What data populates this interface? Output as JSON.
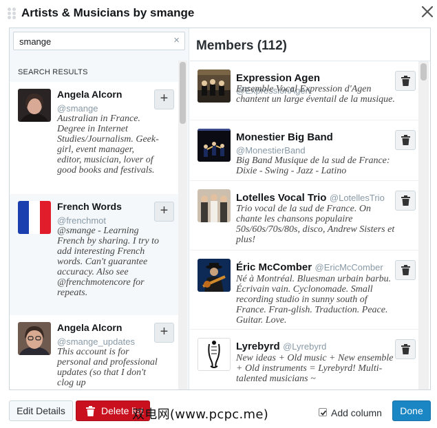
{
  "dialog": {
    "title": "Artists & Musicians by smange"
  },
  "search": {
    "value": "smange",
    "clear": "×"
  },
  "left_panel": {
    "results_label": "SEARCH RESULTS",
    "add": "+",
    "results": [
      {
        "name": "Angela Alcorn",
        "handle": "@smange",
        "bio": "Australian in France. Degree in Internet Studies/Journalism. Geek-girl, event manager, editor, musician, lover of good books and festivals."
      },
      {
        "name": "French Words",
        "handle": "@frenchmot",
        "bio": "@smange - Learning French by sharing. I try to add interesting French words. Can't guarantee accuracy. Also see @frenchmotencore for repeats."
      },
      {
        "name": "Angela Alcorn",
        "handle": "@smange_updates",
        "bio": "This account is for personal and professional updates (so that I don't clog up"
      }
    ]
  },
  "right_panel": {
    "title": "Members (112)",
    "members": [
      {
        "name": "Expression Agen",
        "handle": "@ExpressionAgen",
        "bio": "Ensemble Vocal Expression d'Agen chantent un large éventail de la musique."
      },
      {
        "name": "Monestier Big Band",
        "handle": "@MonestierBand",
        "bio": "Big Band Musique de la sud de France: Dixie - Swing - Jazz - Latino"
      },
      {
        "name": "Lotelles Vocal Trio",
        "handle": "@LotellesTrio",
        "bio": "Trio vocal de la sud de France. On chante les chansons populaire 50s/60s/70s/80s, disco, Andrew Sisters et plus!"
      },
      {
        "name": "Éric McComber",
        "handle": "@EricMcComber",
        "bio": "Né à Montréal. Bluesman urbain barbu. Écrivain vain. Cyclonomade. Small recording studio in sunny south of France. Fran-glish. Traduction. Peace. Guitar. Love."
      },
      {
        "name": "Lyrebyrd",
        "handle": "@Lyrebyrd",
        "bio": "New ideas + Old music + New ensemble + Old instruments = Lyrebyrd! Multi-talented musicians ~"
      }
    ]
  },
  "footer": {
    "edit_label": "Edit Details",
    "delete_label": "Delete list",
    "add_column_label": "Add column",
    "add_column_checked": true,
    "done_label": "Done",
    "watermark": "双电网(www.pcpc.me)"
  },
  "colors": {
    "accent": "#1b86c4",
    "danger": "#c8101f"
  },
  "icons": {
    "close": "close-icon",
    "trash": "trash-icon",
    "plus": "plus-icon",
    "grip": "drag-handle-icon"
  }
}
